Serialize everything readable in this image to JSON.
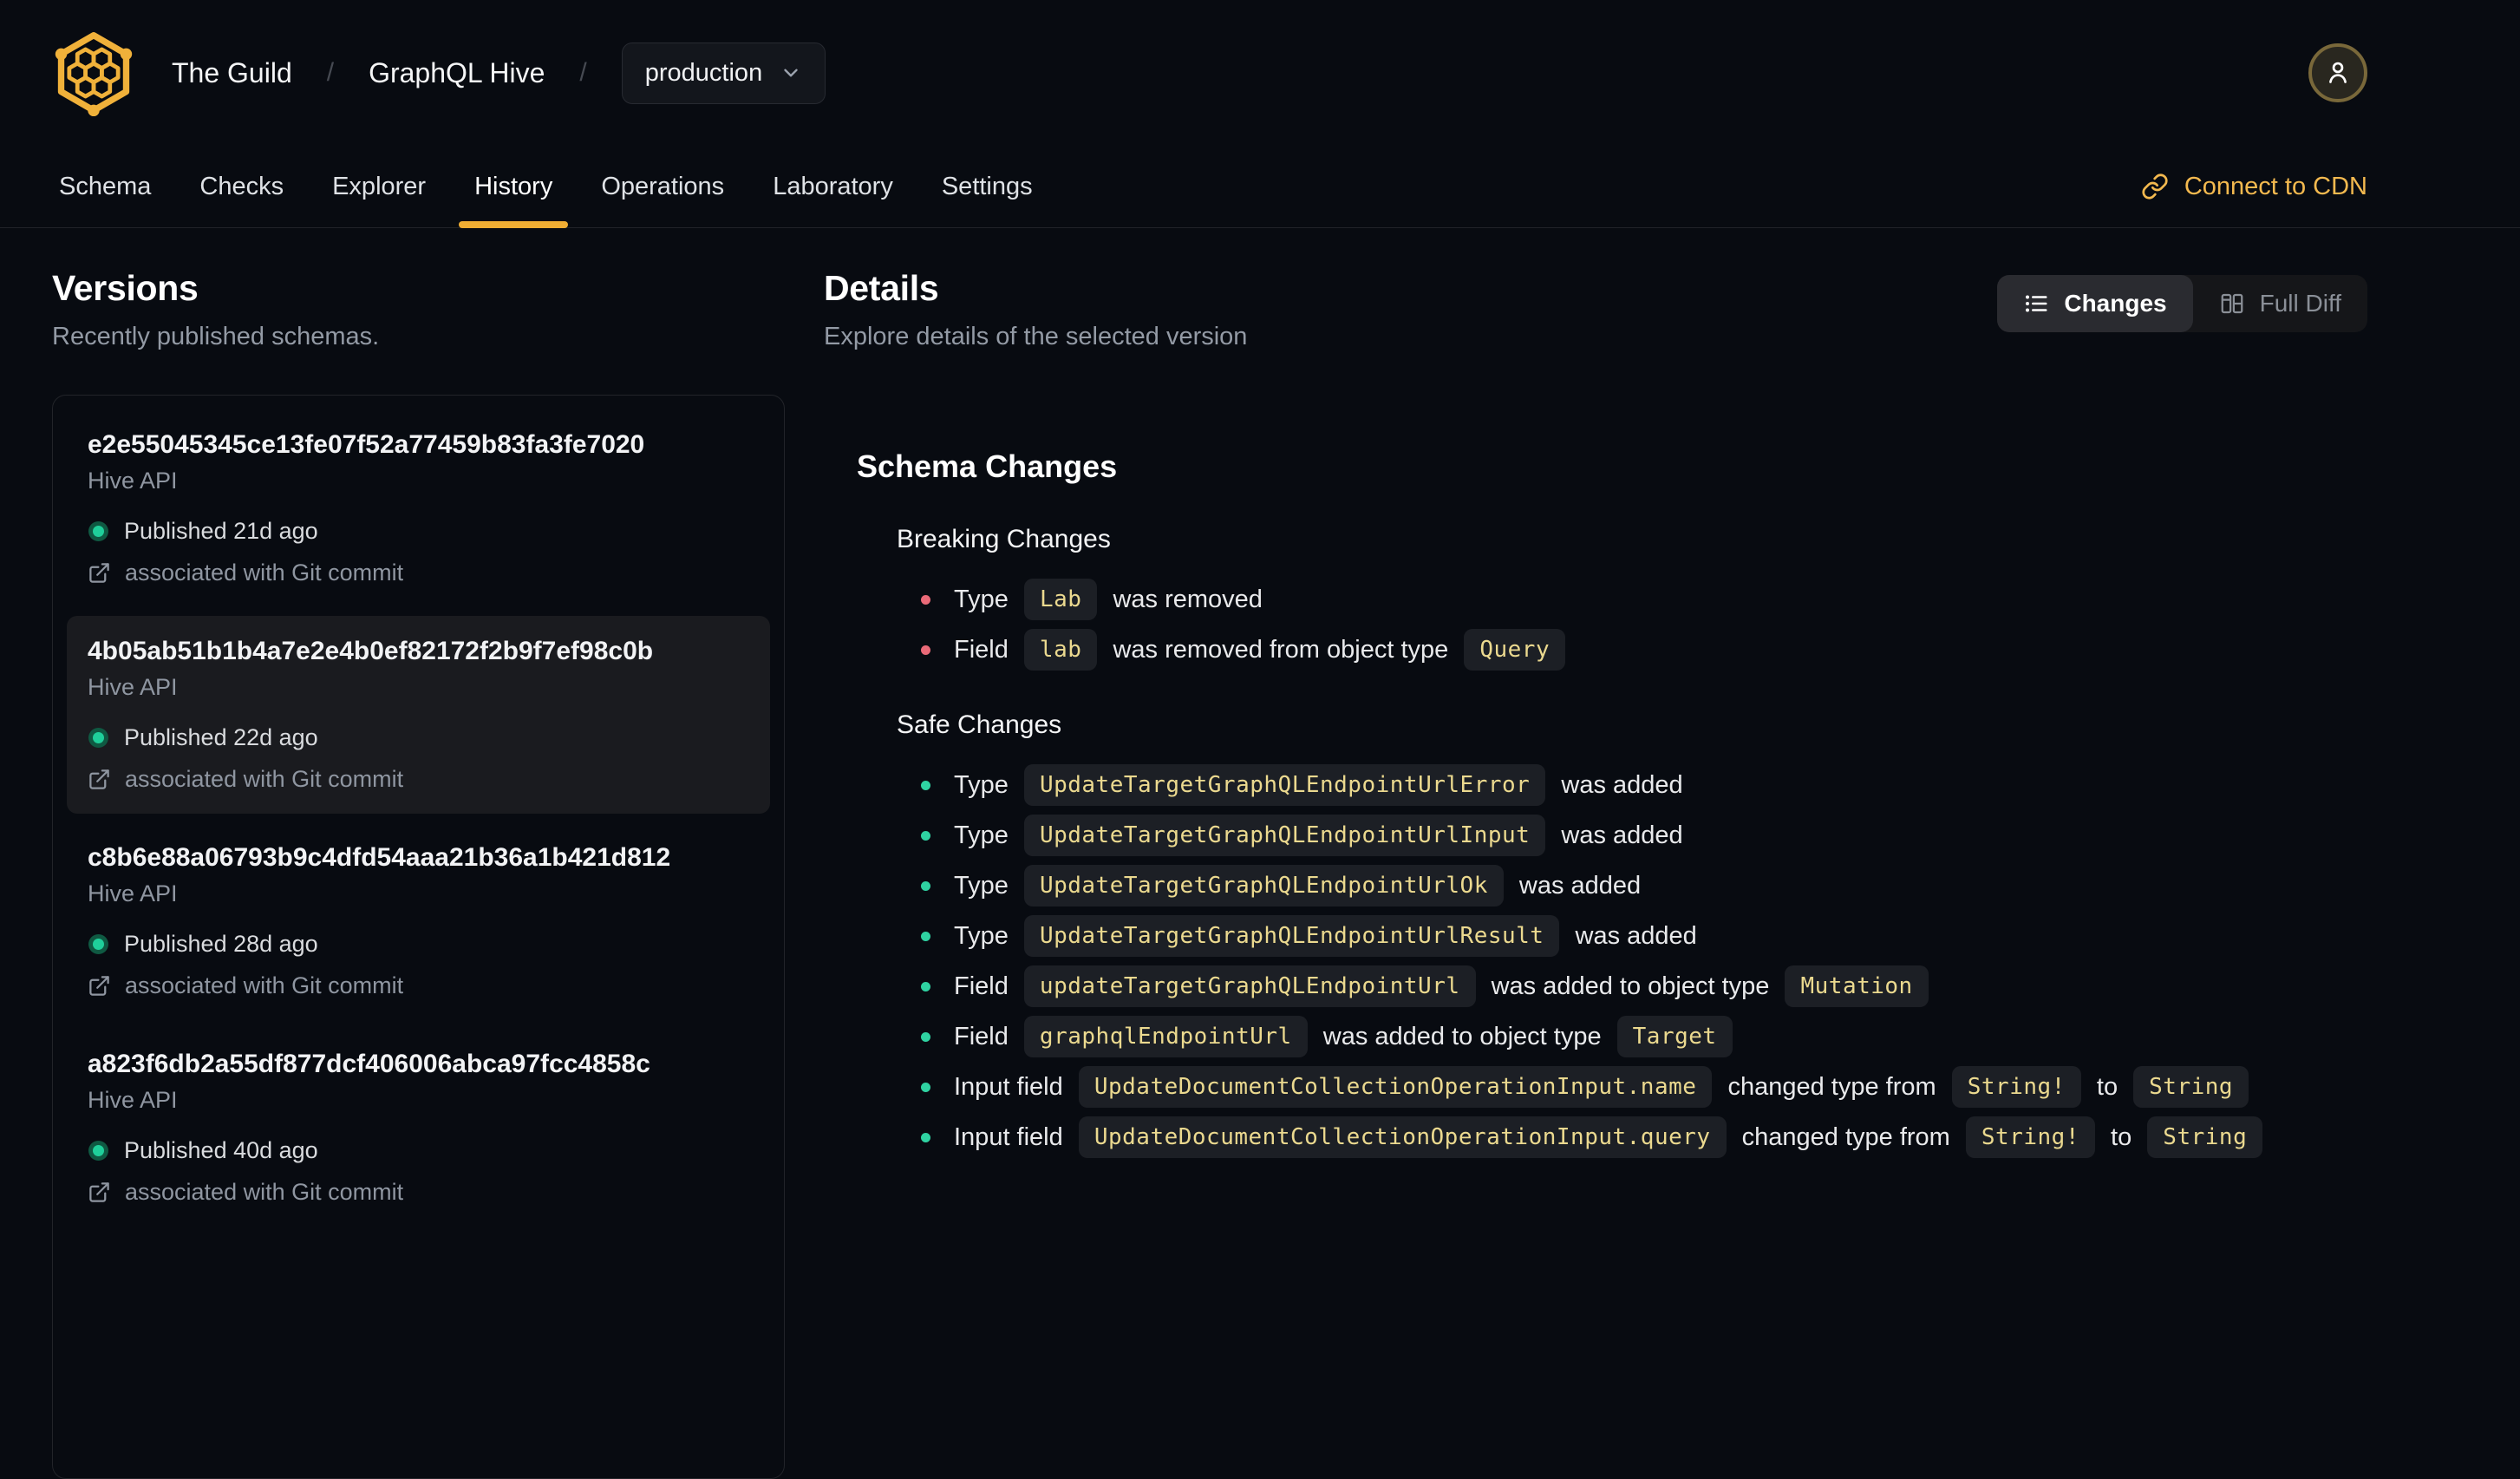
{
  "header": {
    "breadcrumb": {
      "org": "The Guild",
      "separator": "/",
      "project": "GraphQL Hive",
      "target": "production"
    },
    "tabs": [
      {
        "label": "Schema",
        "active": false
      },
      {
        "label": "Checks",
        "active": false
      },
      {
        "label": "Explorer",
        "active": false
      },
      {
        "label": "History",
        "active": true
      },
      {
        "label": "Operations",
        "active": false
      },
      {
        "label": "Laboratory",
        "active": false
      },
      {
        "label": "Settings",
        "active": false
      }
    ],
    "connect_cdn": "Connect to CDN"
  },
  "versions": {
    "title": "Versions",
    "subtitle": "Recently published schemas.",
    "items": [
      {
        "hash": "e2e55045345ce13fe07f52a77459b83fa3fe7020",
        "service": "Hive API",
        "published": "Published 21d ago",
        "git": "associated with Git commit",
        "selected": false
      },
      {
        "hash": "4b05ab51b1b4a7e2e4b0ef82172f2b9f7ef98c0b",
        "service": "Hive API",
        "published": "Published 22d ago",
        "git": "associated with Git commit",
        "selected": true
      },
      {
        "hash": "c8b6e88a06793b9c4dfd54aaa21b36a1b421d812",
        "service": "Hive API",
        "published": "Published 28d ago",
        "git": "associated with Git commit",
        "selected": false
      },
      {
        "hash": "a823f6db2a55df877dcf406006abca97fcc4858c",
        "service": "Hive API",
        "published": "Published 40d ago",
        "git": "associated with Git commit",
        "selected": false
      }
    ]
  },
  "details": {
    "title": "Details",
    "subtitle": "Explore details of the selected version",
    "view_toggle": {
      "changes": "Changes",
      "full_diff": "Full Diff",
      "active": "Changes"
    },
    "schema_changes": {
      "title": "Schema Changes",
      "sections": [
        {
          "name": "Breaking Changes",
          "severity": "breaking",
          "items": [
            [
              {
                "t": "Type "
              },
              {
                "c": "Lab"
              },
              {
                "t": " was removed"
              }
            ],
            [
              {
                "t": "Field "
              },
              {
                "c": "lab"
              },
              {
                "t": " was removed from object type "
              },
              {
                "c": "Query"
              }
            ]
          ]
        },
        {
          "name": "Safe Changes",
          "severity": "safe",
          "items": [
            [
              {
                "t": "Type "
              },
              {
                "c": "UpdateTargetGraphQLEndpointUrlError"
              },
              {
                "t": " was added"
              }
            ],
            [
              {
                "t": "Type "
              },
              {
                "c": "UpdateTargetGraphQLEndpointUrlInput"
              },
              {
                "t": " was added"
              }
            ],
            [
              {
                "t": "Type "
              },
              {
                "c": "UpdateTargetGraphQLEndpointUrlOk"
              },
              {
                "t": " was added"
              }
            ],
            [
              {
                "t": "Type "
              },
              {
                "c": "UpdateTargetGraphQLEndpointUrlResult"
              },
              {
                "t": " was added"
              }
            ],
            [
              {
                "t": "Field "
              },
              {
                "c": "updateTargetGraphQLEndpointUrl"
              },
              {
                "t": " was added to object type "
              },
              {
                "c": "Mutation"
              }
            ],
            [
              {
                "t": "Field "
              },
              {
                "c": "graphqlEndpointUrl"
              },
              {
                "t": " was added to object type "
              },
              {
                "c": "Target"
              }
            ],
            [
              {
                "t": "Input field "
              },
              {
                "c": "UpdateDocumentCollectionOperationInput.name"
              },
              {
                "t": " changed type from "
              },
              {
                "c": "String!"
              },
              {
                "t": " to "
              },
              {
                "c": "String"
              }
            ],
            [
              {
                "t": "Input field "
              },
              {
                "c": "UpdateDocumentCollectionOperationInput.query"
              },
              {
                "t": " changed type from "
              },
              {
                "c": "String!"
              },
              {
                "t": " to "
              },
              {
                "c": "String"
              }
            ]
          ]
        }
      ]
    }
  },
  "icons": {
    "logo": "hive-honeycomb-hexagon",
    "target_select": "chevron-down",
    "avatar": "person",
    "connect_cdn": "link-chain",
    "changes_view": "bulleted-list",
    "full_diff_view": "split-columns",
    "published_status": "green-dot",
    "git_commit": "external-link"
  },
  "colors": {
    "background": "#080b11",
    "accent_amber": "#f0ad33",
    "cdn_link": "#f3b94f",
    "breaking_bullet": "#ea6a78",
    "safe_bullet": "#2fd3a2",
    "code_text": "#ebd98f",
    "code_bg": "#1c1f25",
    "published_dot": "#1fcf9a",
    "selected_item_bg": "#1a1b1f"
  }
}
